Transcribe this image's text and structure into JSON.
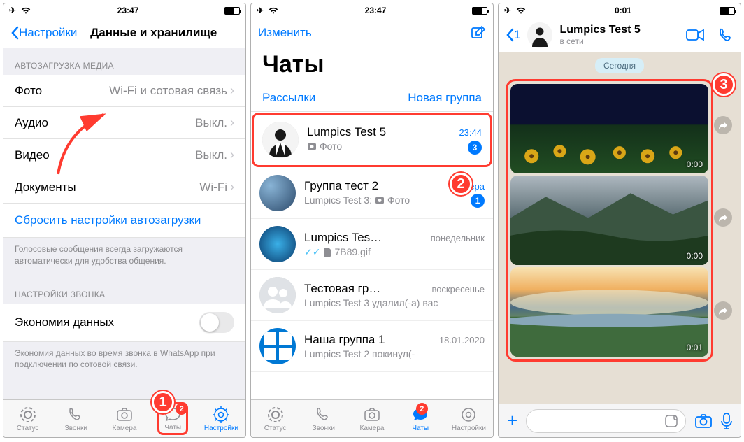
{
  "status": {
    "time1": "23:47",
    "time2": "23:47",
    "time3": "0:01"
  },
  "annotations": {
    "b1": "1",
    "b2": "2",
    "b3": "3"
  },
  "screen1": {
    "back": "Настройки",
    "title": "Данные и хранилище",
    "sect_media": "АВТОЗАГРУЗКА МЕДИА",
    "rows": {
      "photo_l": "Фото",
      "photo_v": "Wi-Fi и сотовая связь",
      "audio_l": "Аудио",
      "audio_v": "Выкл.",
      "video_l": "Видео",
      "video_v": "Выкл.",
      "docs_l": "Документы",
      "docs_v": "Wi-Fi"
    },
    "reset": "Сбросить настройки автозагрузки",
    "note1": "Голосовые сообщения всегда загружаются автоматически для удобства общения.",
    "sect_call": "НАСТРОЙКИ ЗВОНКА",
    "saving": "Экономия данных",
    "note2": "Экономия данных во время звонка в WhatsApp при подключении по сотовой связи."
  },
  "tabs": {
    "status": "Статус",
    "calls": "Звонки",
    "camera": "Камера",
    "chats": "Чаты",
    "settings": "Настройки",
    "badge": "2"
  },
  "screen2": {
    "edit": "Изменить",
    "title": "Чаты",
    "broadcast": "Рассылки",
    "newgroup": "Новая группа",
    "chat1": {
      "name": "Lumpics Test 5",
      "preview": "Фото",
      "time": "23:44",
      "unread": "3"
    },
    "chat2": {
      "name": "Группа тест 2",
      "sender": "Lumpics Test 3:",
      "preview": "Фото",
      "time": "вчера",
      "unread": "1"
    },
    "chat3": {
      "name": "Lumpics Tes…",
      "preview": "7B89.gif",
      "time": "понедельник"
    },
    "chat4": {
      "name": "Тестовая гр…",
      "preview": "Lumpics Test 3 удалил(-а) вас",
      "time": "воскресенье"
    },
    "chat5": {
      "name": "Наша группа 1",
      "preview": "Lumpics Test 2 покинул(-",
      "time": "18.01.2020"
    }
  },
  "screen3": {
    "back": "1",
    "name": "Lumpics Test 5",
    "status": "в сети",
    "today": "Сегодня",
    "dur1": "0:00",
    "dur2": "0:00",
    "dur3": "0:01"
  }
}
